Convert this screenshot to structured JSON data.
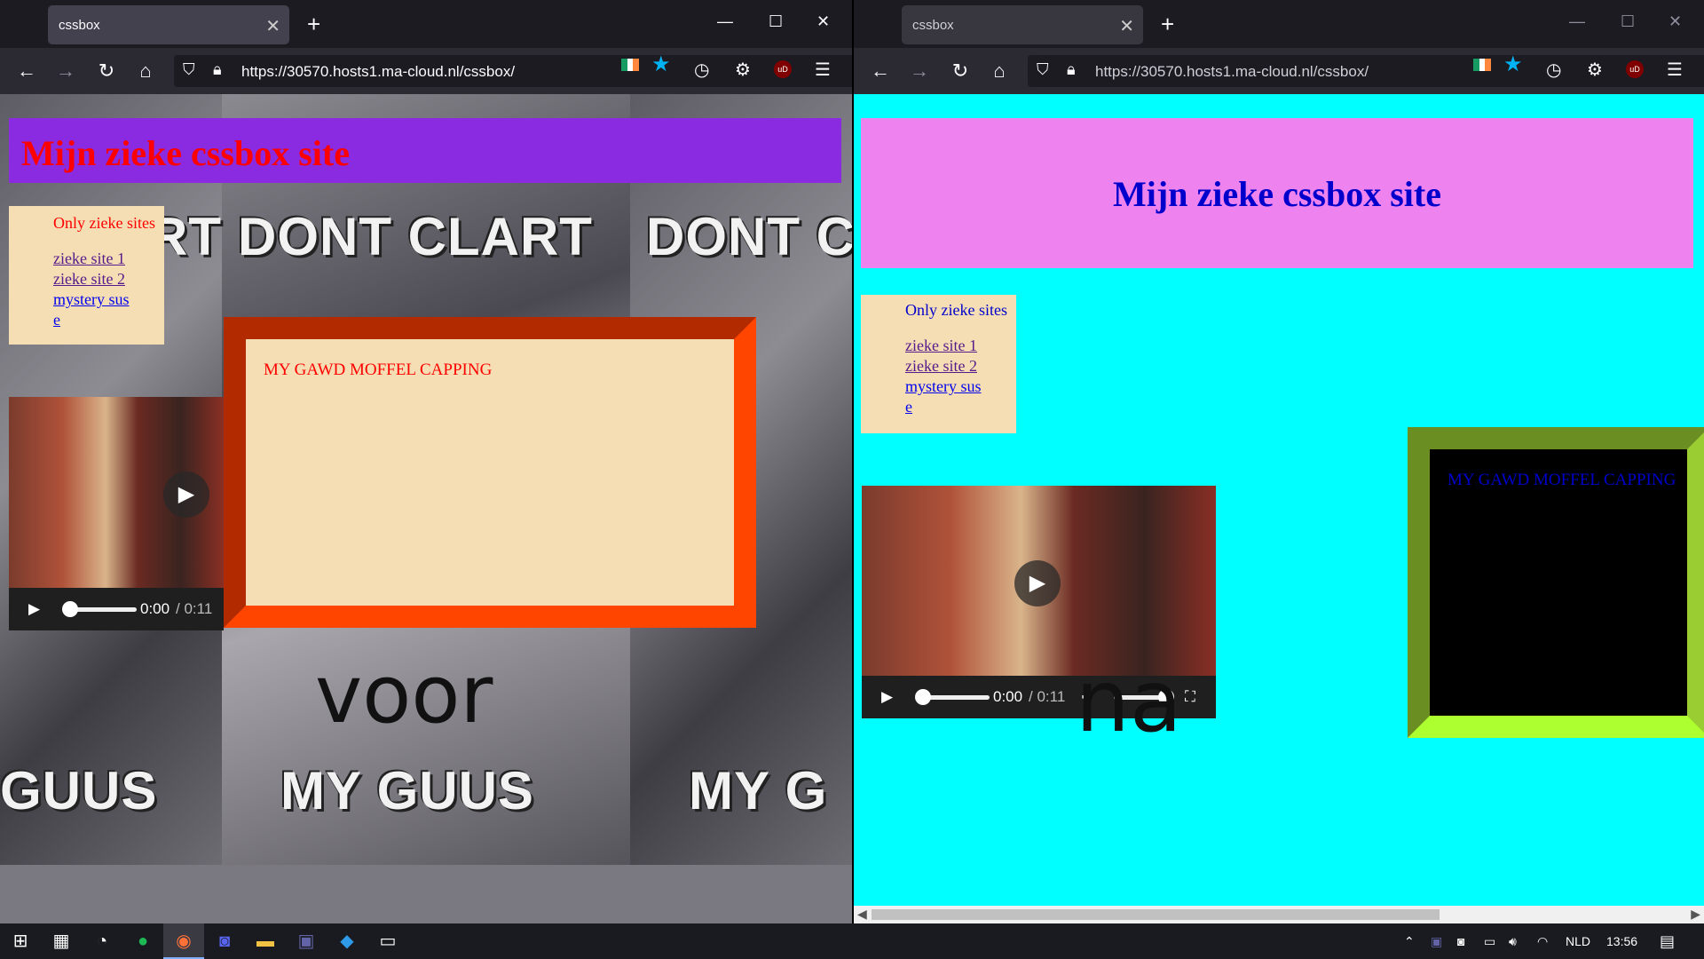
{
  "left_window": {
    "tab_title": "cssbox",
    "url": "https://30570.hosts1.ma-cloud.nl/cssbox/",
    "page": {
      "heading": "Mijn zieke cssbox site",
      "sidebar": {
        "title": "Only zieke sites",
        "links": [
          "zieke site 1",
          "zieke site 2",
          "mystery sus",
          "e"
        ]
      },
      "box_text": "MY GAWD MOFFEL CAPPING",
      "video": {
        "time": "0:00",
        "duration": "/ 0:11"
      },
      "big_word": "voor",
      "background_texts": [
        "DONT CLART",
        "DONT C",
        "RT",
        "MY GUUS",
        "GUUS",
        "MY G"
      ]
    }
  },
  "right_window": {
    "tab_title": "cssbox",
    "url": "https://30570.hosts1.ma-cloud.nl/cssbox/",
    "page": {
      "heading": "Mijn zieke cssbox site",
      "sidebar": {
        "title": "Only zieke sites",
        "links": [
          "zieke site 1",
          "zieke site 2",
          "mystery sus",
          "e"
        ]
      },
      "box_text": "MY GAWD MOFFEL CAPPING",
      "video": {
        "time": "0:00",
        "duration": "/ 0:11"
      },
      "big_word": "na"
    }
  },
  "taskbar": {
    "language": "NLD",
    "clock": "13:56"
  },
  "colors": {
    "left_header": "#8a2be2",
    "right_header": "#ee82ee",
    "right_background": "#00ffff",
    "sidebar": "#f5deb3",
    "link": "#0000cd"
  }
}
